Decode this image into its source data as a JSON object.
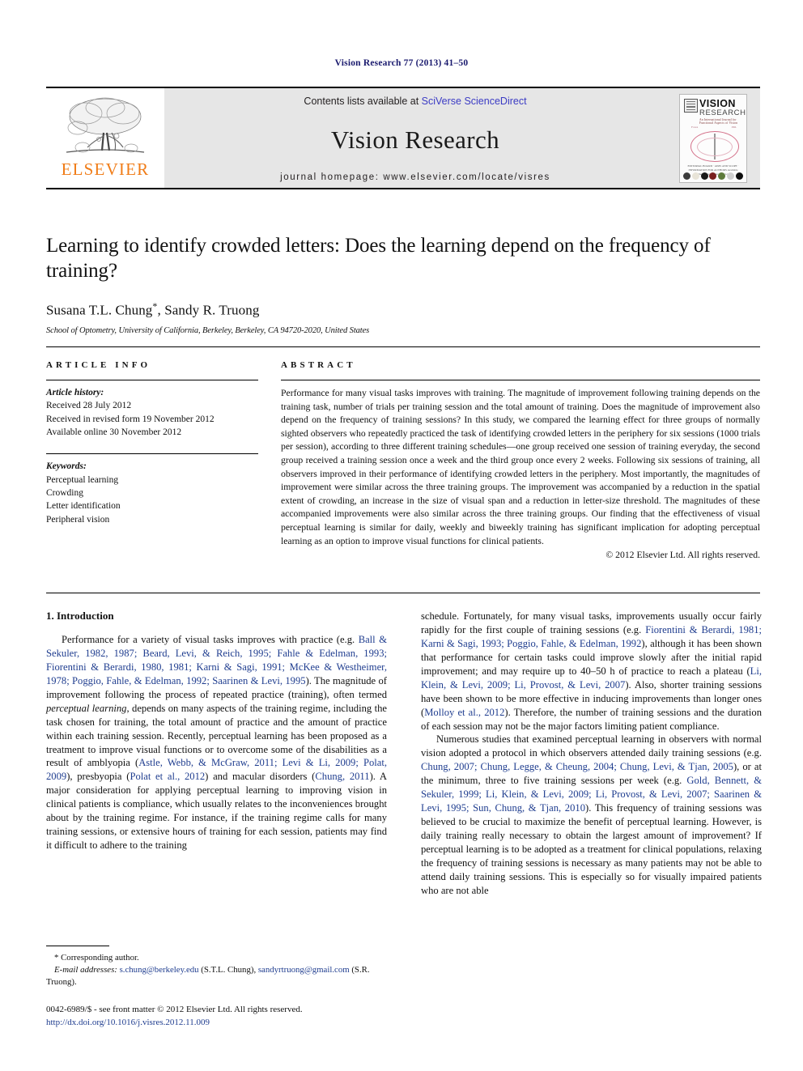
{
  "running_head": "Vision Research 77 (2013) 41–50",
  "masthead": {
    "publisher_name": "ELSEVIER",
    "contents_prefix": "Contents lists available at ",
    "contents_link": "SciVerse ScienceDirect",
    "journal_name": "Vision Research",
    "homepage": "journal homepage: www.elsevier.com/locate/visres",
    "cover": {
      "title": "VISION",
      "subtitle": "RESEARCH",
      "tagline": "An International Journal for Functional Aspects of Vision",
      "caption": "EDITORIAL BOARD · AIMS AND SCOPE · INFORMATION FOR AUTHORS\nAvailable online at www.sciencedirect.com",
      "left_mark": "Fovea",
      "right_mark": "PRL",
      "dot_colors": [
        "#3c3c3c",
        "#e8e4d8",
        "#1a1a1a",
        "#7a1f1f",
        "#5d7a3a",
        "#cfcfcf",
        "#0d0d0d"
      ]
    }
  },
  "article": {
    "title": "Learning to identify crowded letters: Does the learning depend on the frequency of training?",
    "authors": "Susana T.L. Chung",
    "corresponding_marker": "*",
    "authors_rest": ", Sandy R. Truong",
    "affiliation": "School of Optometry, University of California, Berkeley, Berkeley, CA 94720-2020, United States"
  },
  "article_info": {
    "heading": "ARTICLE INFO",
    "history_label": "Article history:",
    "history": [
      "Received 28 July 2012",
      "Received in revised form 19 November 2012",
      "Available online 30 November 2012"
    ],
    "keywords_label": "Keywords:",
    "keywords": [
      "Perceptual learning",
      "Crowding",
      "Letter identification",
      "Peripheral vision"
    ]
  },
  "abstract": {
    "heading": "ABSTRACT",
    "text": "Performance for many visual tasks improves with training. The magnitude of improvement following training depends on the training task, number of trials per training session and the total amount of training. Does the magnitude of improvement also depend on the frequency of training sessions? In this study, we compared the learning effect for three groups of normally sighted observers who repeatedly practiced the task of identifying crowded letters in the periphery for six sessions (1000 trials per session), according to three different training schedules—one group received one session of training everyday, the second group received a training session once a week and the third group once every 2 weeks. Following six sessions of training, all observers improved in their performance of identifying crowded letters in the periphery. Most importantly, the magnitudes of improvement were similar across the three training groups. The improvement was accompanied by a reduction in the spatial extent of crowding, an increase in the size of visual span and a reduction in letter-size threshold. The magnitudes of these accompanied improvements were also similar across the three training groups. Our finding that the effectiveness of visual perceptual learning is similar for daily, weekly and biweekly training has significant implication for adopting perceptual learning as an option to improve visual functions for clinical patients.",
    "copyright": "© 2012 Elsevier Ltd. All rights reserved."
  },
  "introduction": {
    "heading": "1. Introduction",
    "left_p1_a": "Performance for a variety of visual tasks improves with practice (e.g. ",
    "left_p1_refs1": "Ball & Sekuler, 1982, 1987; Beard, Levi, & Reich, 1995; Fahle & Edelman, 1993; Fiorentini & Berardi, 1980, 1981; Karni & Sagi, 1991; McKee & Westheimer, 1978; Poggio, Fahle, & Edelman, 1992; Saarinen & Levi, 1995",
    "left_p1_b": "). The magnitude of improvement following the process of repeated practice (training), often termed ",
    "left_p1_em": "perceptual learning",
    "left_p1_c": ", depends on many aspects of the training regime, including the task chosen for training, the total amount of practice and the amount of practice within each training session. Recently, perceptual learning has been proposed as a treatment to improve visual functions or to overcome some of the disabilities as a result of amblyopia (",
    "left_p1_refs2": "Astle, Webb, & McGraw, 2011; Levi & Li, 2009; Polat, 2009",
    "left_p1_d": "), presbyopia (",
    "left_p1_refs3": "Polat et al., 2012",
    "left_p1_e": ") and macular disorders (",
    "left_p1_refs4": "Chung, 2011",
    "left_p1_f": "). A major consideration for applying perceptual learning to improving vision in clinical patients is compliance, which usually relates to the inconveniences brought about by the training regime. For instance, if the training regime calls for many training sessions, or extensive hours of training for each session, patients may find it difficult to adhere to the training",
    "right_p1_a": "schedule. Fortunately, for many visual tasks, improvements usually occur fairly rapidly for the first couple of training sessions (e.g. ",
    "right_p1_refs1": "Fiorentini & Berardi, 1981; Karni & Sagi, 1993; Poggio, Fahle, & Edelman, 1992",
    "right_p1_b": "), although it has been shown that performance for certain tasks could improve slowly after the initial rapid improvement; and may require up to 40–50 h of practice to reach a plateau (",
    "right_p1_refs2": "Li, Klein, & Levi, 2009; Li, Provost, & Levi, 2007",
    "right_p1_c": "). Also, shorter training sessions have been shown to be more effective in inducing improvements than longer ones (",
    "right_p1_refs3": "Molloy et al., 2012",
    "right_p1_d": "). Therefore, the number of training sessions and the duration of each session may not be the major factors limiting patient compliance.",
    "right_p2_a": "Numerous studies that examined perceptual learning in observers with normal vision adopted a protocol in which observers attended daily training sessions (e.g. ",
    "right_p2_refs1": "Chung, 2007; Chung, Legge, & Cheung, 2004; Chung, Levi, & Tjan, 2005",
    "right_p2_b": "), or at the minimum, three to five training sessions per week (e.g. ",
    "right_p2_refs2": "Gold, Bennett, & Sekuler, 1999; Li, Klein, & Levi, 2009; Li, Provost, & Levi, 2007; Saarinen & Levi, 1995; Sun, Chung, & Tjan, 2010",
    "right_p2_c": "). This frequency of training sessions was believed to be crucial to maximize the benefit of perceptual learning. However, is daily training really necessary to obtain the largest amount of improvement? If perceptual learning is to be adopted as a treatment for clinical populations, relaxing the frequency of training sessions is necessary as many patients may not be able to attend daily training sessions. This is especially so for visually impaired patients who are not able"
  },
  "footnote": {
    "corresponding": "Corresponding author.",
    "email_label": "E-mail addresses:",
    "email1": "s.chung@berkeley.edu",
    "email1_owner": " (S.T.L. Chung), ",
    "email2": "sandyrtruong@gmail.com",
    "email2_owner": " (S.R. Truong)."
  },
  "imprint": {
    "line1": "0042-6989/$ - see front matter © 2012 Elsevier Ltd. All rights reserved.",
    "doi": "http://dx.doi.org/10.1016/j.visres.2012.11.009"
  }
}
